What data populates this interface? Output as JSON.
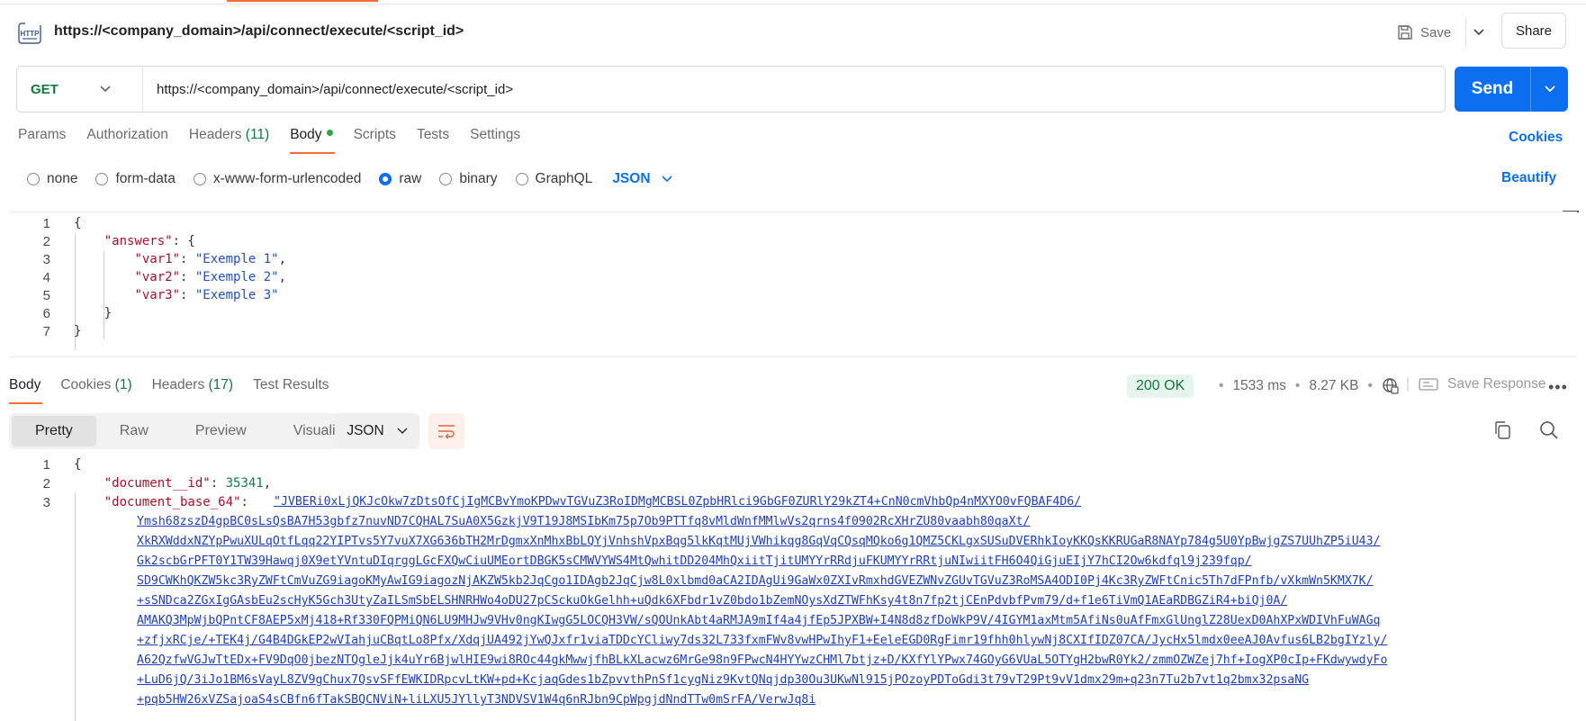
{
  "request": {
    "title": "https://<company_domain>/api/connect/execute/<script_id>",
    "method": "GET",
    "url": "https://<company_domain>/api/connect/execute/<script_id>",
    "save_label": "Save",
    "share_label": "Share",
    "send_label": "Send",
    "http_icon_text": "HTTP"
  },
  "request_tabs": {
    "params": "Params",
    "authorization": "Authorization",
    "headers": "Headers",
    "headers_count": "(11)",
    "body": "Body",
    "scripts": "Scripts",
    "tests": "Tests",
    "settings": "Settings",
    "active": "Body"
  },
  "cookies_label": "Cookies",
  "body_types": {
    "options": [
      "none",
      "form-data",
      "x-www-form-urlencoded",
      "raw",
      "binary",
      "GraphQL"
    ],
    "selected": "raw",
    "format": "JSON",
    "beautify_label": "Beautify"
  },
  "request_body": {
    "line_numbers": [
      "1",
      "2",
      "3",
      "4",
      "5",
      "6",
      "7"
    ],
    "open_brace": "{",
    "answers_key": "\"answers\"",
    "var1_key": "\"var1\"",
    "var1_val": "\"Exemple 1\"",
    "var2_key": "\"var2\"",
    "var2_val": "\"Exemple 2\"",
    "var3_key": "\"var3\"",
    "var3_val": "\"Exemple 3\"",
    "close_inner": "}",
    "close_brace": "}"
  },
  "response_tabs": {
    "body": "Body",
    "cookies": "Cookies",
    "cookies_count": "(1)",
    "headers": "Headers",
    "headers_count": "(17)",
    "test_results": "Test Results",
    "active": "Body"
  },
  "response_meta": {
    "status": "200 OK",
    "time": "1533 ms",
    "size": "8.27 KB",
    "save_response_label": "Save Response"
  },
  "view_modes": {
    "pretty": "Pretty",
    "raw": "Raw",
    "preview": "Preview",
    "visualize": "Visualize",
    "active": "Pretty",
    "format": "JSON"
  },
  "response_body": {
    "line_numbers": [
      "1",
      "2",
      "3"
    ],
    "open_brace": "{",
    "doc_id_key": "\"document__id\"",
    "doc_id_val": "35341",
    "b64_key": "\"document_base_64\"",
    "b64_lines": [
      "\"JVBERi0xLjQKJcOkw7zDtsOfCjIgMCBvYmoKPDwvTGVuZ3RoIDMgMCBSL0ZpbHRlci9GbGF0ZURlY29kZT4+CnN0cmVhbQp4nMXYO0vFQBAF4D6/",
      "Ymsh68zszD4gpBC0sLsQsBA7H53gbfz7nuvND7CQHAL7SuA0X5GzkjV9T19J8MSIbKm75p7Ob9PTTfq8vMldWnfMMlwVs2qrns4f0902RcXHrZU80vaabh80qaXt/",
      "XkRXWddxNZYpPwuXULqOtfLqq22YIPTvs5Y7vuX7XG636bTH2MrDgmxXnMhxBbLQYjVnhshVpxBqg5lkKqtMUjVWhikqg8GqVqCQsqMQko6g1QMZ5CKLgxSUSuDVERhkIoyKKQsKKRUGaR8NAYp784g5U0YpBwjgZS7UUhZP5iU43/",
      "Gk2scbGrPFT0Y1TW39Hawqj0X9etYVntuDIqrggLGcFXQwCiuUMEortDBGK5sCMWVYWS4MtQwhitDD204MhQxiitTjitUMYYrRRdjuFKUMYYrRRtjuNIwiitFH6O4QiGjuEIjY7hCI2Ow6kdfql9j239fqp/",
      "SD9CWKhQKZW5kc3RyZWFtCmVuZG9iagoKMyAwIG9iagozNjAKZW5kb2JqCgo1IDAgb2JqCjw8L0xlbmd0aCA2IDAgUi9GaWx0ZXIvRmxhdGVEZWNvZGUvTGVuZ3RoMSA4ODI0Pj4Kc3RyZWFtCnic5Th7dFPnfb/vXkmWn5KMX7K/",
      "+sSNDca2ZGxIgGAsbEu2scHyK5Gch3UtyZaILSmSbELSHNRHWo4oDU27pCSckuOkGelhh+uQdk6XFbdr1vZ0bdo1bZemNOysXdZTWFhKsy4t8n7fp2tjCEnPdvbfPvm79/d+f1e6TiVmQ1AEaRDBGZiR4+biQj0A/",
      "AMAKQ3MpWjbQPntCF8AEP5xMj418+Rf330FQPMiQN6LU9MHJw9VHv0ngKIwgG5LOCQH3VW/sQOUnkAbt4aRMJA9mIf4a4jfEp5JPXBW+I4N8d8zfDoWkP9V/4IGYM1axMtm5AfiNs0uAfFmxGlUnglZ28UexD0AhXPxWDIVhFuWAGq",
      "+zfjxRCje/+TEK4j/G4B4DGkEP2wVIahjuCBqtLo8Pfx/XdqjUA492jYwQJxfr1viaTDDcYCliwy7ds32L733fxmFWv8vwHPwIhyF1+EeleEGD0RgFimr19fhh0hlywNj8CXIfIDZ07CA/JycHx5lmdx0eeAJ0Avfus6LB2bgIYzly/",
      "A62QzfwVGJwTtEDx+FV9DqO0jbezNTQgleJjk4uYr6BjwlHIE9wi8ROc44gkMwwjfhBLkXLacwz6MrGe98n9FPwcN4HYYwzCHMl7btjz+D/KXfYlYPwx74GOyG6VUaL5OTYgH2bwR0Yk2/zmmOZWZej7hf+IogXP0cIp+FKdwywdyFo",
      "+LuD6jQ/3iJo1BM6sVayL8ZV9gChux7QsvSFfEWKIDRpcvLtKW+pd+KcjaqGdes1bZpvvthPnSf1cygNiz9KvtQNqjdp30Ou3UKwNl915jPOzoyPDToGdi3t79vT29Pt9vV1dmx29m+q23n7Tu2b7vt1q2bmx32psaNG",
      "+pqb5HW26xVZSajoaS4sCBfn6fTakSBQCNViN+liLXU5JYllyT3NDVSV1W4q6nRJbn9CpWpgjdNndTTw0mSrFA/VerwJq8i"
    ]
  }
}
